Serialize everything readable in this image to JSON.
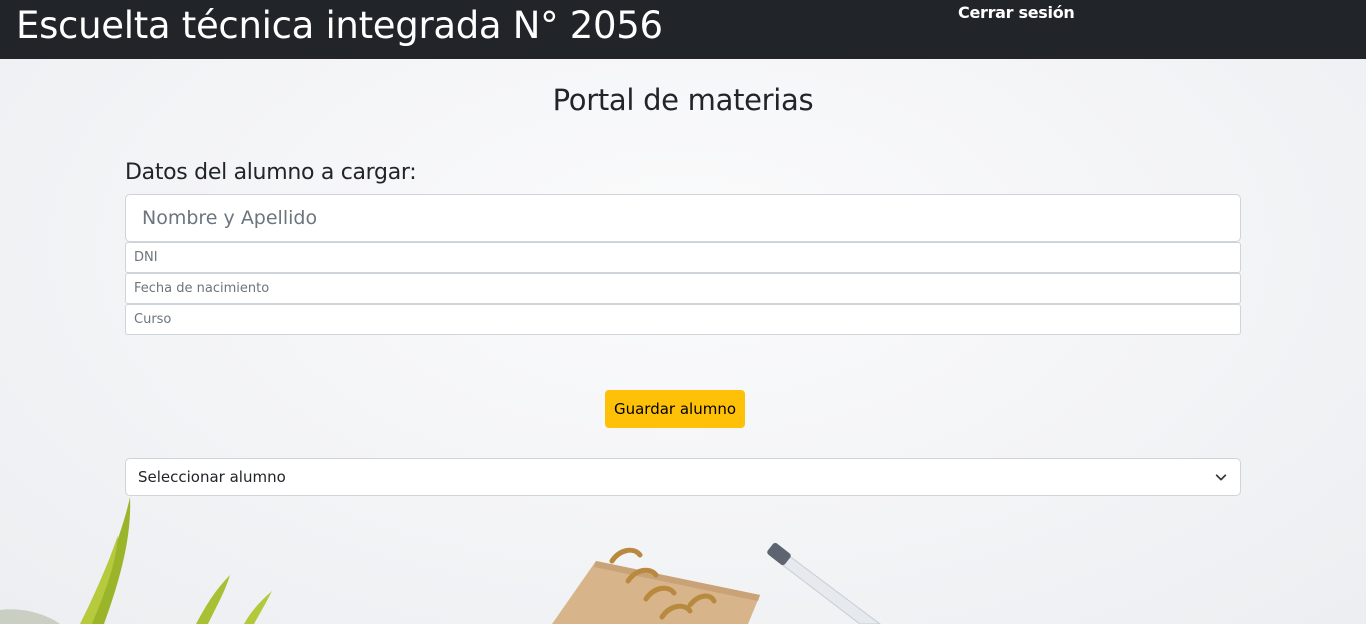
{
  "header": {
    "brand": "Escuelta técnica integrada N° 2056",
    "logout_label": "Cerrar sesión"
  },
  "main": {
    "title": "Portal de materias",
    "section_label": "Datos del alumno a cargar:",
    "fields": {
      "nombre_placeholder": "Nombre y Apellido",
      "dni_placeholder": "DNI",
      "fecha_placeholder": "Fecha de nacimiento",
      "curso_placeholder": "Curso"
    },
    "save_button_label": "Guardar alumno",
    "select": {
      "selected": "Seleccionar alumno",
      "icon": "chevron-down-icon"
    }
  },
  "colors": {
    "navbar_bg": "#212529",
    "accent": "#ffc107",
    "background": "#f4f5f7"
  },
  "decoration": {
    "plant": "plant-leaves-illustration",
    "notebook": "spiral-notebook-illustration",
    "pen": "pen-illustration"
  }
}
